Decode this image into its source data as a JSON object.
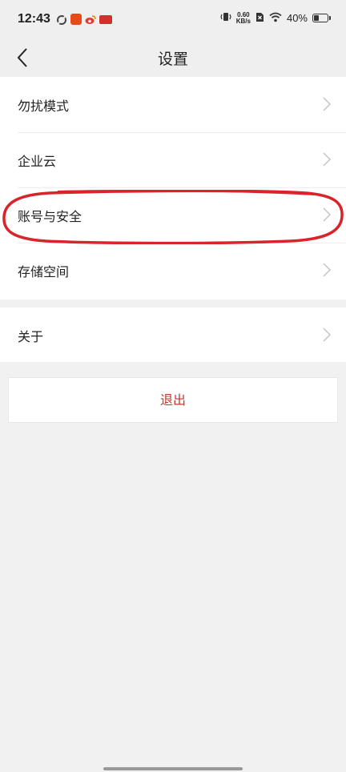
{
  "status_bar": {
    "time": "12:43",
    "net_speed_value": "0.60",
    "net_speed_unit": "KB/s",
    "battery_text": "40%",
    "battery_level": 0.4
  },
  "header": {
    "title": "设置"
  },
  "menu_groups": [
    {
      "items": [
        {
          "label": "勿扰模式"
        },
        {
          "label": "企业云"
        },
        {
          "label": "账号与安全",
          "highlighted": true
        },
        {
          "label": "存储空间"
        }
      ]
    },
    {
      "items": [
        {
          "label": "关于"
        }
      ]
    }
  ],
  "logout": {
    "label": "退出"
  },
  "colors": {
    "logout_text": "#c0392b",
    "highlight_ring": "#d9242b",
    "background": "#f1f1f1"
  }
}
